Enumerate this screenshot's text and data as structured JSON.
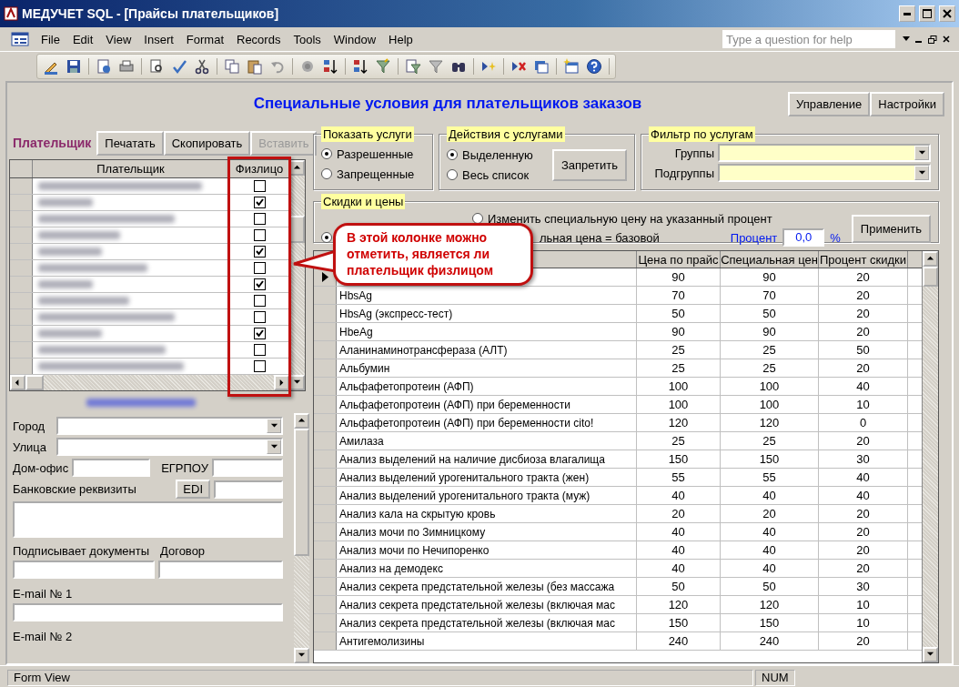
{
  "window": {
    "title": "МЕДУЧЕТ SQL - [Прайсы плательщиков]"
  },
  "menu": [
    "File",
    "Edit",
    "View",
    "Insert",
    "Format",
    "Records",
    "Tools",
    "Window",
    "Help"
  ],
  "help_box": {
    "placeholder": "Type a question for help"
  },
  "form": {
    "title": "Специальные условия для плательщиков заказов",
    "buttons": [
      "Управление",
      "Настройки"
    ]
  },
  "payer": {
    "label": "Плательщик",
    "buttons": [
      {
        "label": "Печатать",
        "disabled": false
      },
      {
        "label": "Скопировать",
        "disabled": false
      },
      {
        "label": "Вставить",
        "disabled": true
      }
    ],
    "columns": [
      "Плательщик",
      "Физлицо"
    ],
    "rows": [
      {
        "individual": false
      },
      {
        "individual": true
      },
      {
        "individual": false
      },
      {
        "individual": false
      },
      {
        "individual": true
      },
      {
        "individual": false
      },
      {
        "individual": true
      },
      {
        "individual": false
      },
      {
        "individual": false
      },
      {
        "individual": true
      },
      {
        "individual": false
      },
      {
        "individual": false
      }
    ]
  },
  "details": {
    "city_label": "Город",
    "street_label": "Улица",
    "office_label": "Дом-офис",
    "code_label": "ЕГРПОУ",
    "edi_button": "EDI",
    "bank_label": "Банковские реквизиты",
    "signer_label": "Подписывает документы",
    "contract_label": "Договор",
    "email1_label": "E-mail № 1",
    "email2_label": "E-mail № 2"
  },
  "show_services": {
    "title": "Показать услуги",
    "options": [
      {
        "label": "Разрешенные",
        "selected": true
      },
      {
        "label": "Запрещенные",
        "selected": false
      }
    ]
  },
  "service_actions": {
    "title": "Действия с услугами",
    "options": [
      {
        "label": "Выделенную",
        "selected": true
      },
      {
        "label": "Весь список",
        "selected": false
      }
    ],
    "button": "Запретить"
  },
  "filter": {
    "title": "Фильтр по услугам",
    "fields": [
      {
        "label": "Группы"
      },
      {
        "label": "Подгруппы"
      }
    ]
  },
  "discounts": {
    "title": "Скидки и цены",
    "options": [
      {
        "label": "Изменить специальную цену на указанный процент",
        "selected": false
      },
      {
        "label": "льная цена = базовой",
        "selected": true
      }
    ],
    "percent_label": "Процент",
    "percent_value": "0,0",
    "percent_unit": "%",
    "button": "Применить"
  },
  "services": {
    "columns": [
      "Цена по прайс",
      "Специальная цен",
      "Процент скидки"
    ],
    "rows": [
      {
        "price": "90",
        "special": "90",
        "discount": "20",
        "current": true
      },
      {
        "name": "HbsAg",
        "price": "70",
        "special": "70",
        "discount": "20",
        "current": false
      },
      {
        "name": "HbsAg (экспресс-тест)",
        "price": "50",
        "special": "50",
        "discount": "20",
        "current": false
      },
      {
        "name": "HbeAg",
        "price": "90",
        "special": "90",
        "discount": "20",
        "current": false
      },
      {
        "name": "Аланинаминотрансфераза (АЛТ)",
        "price": "25",
        "special": "25",
        "discount": "50",
        "current": false
      },
      {
        "name": "Альбумин",
        "price": "25",
        "special": "25",
        "discount": "20",
        "current": false
      },
      {
        "name": "Альфафетопротеин (АФП)",
        "price": "100",
        "special": "100",
        "discount": "40",
        "current": false
      },
      {
        "name": "Альфафетопротеин (АФП) при беременности",
        "price": "100",
        "special": "100",
        "discount": "10",
        "current": false
      },
      {
        "name": "Альфафетопротеин (АФП) при беременности cito!",
        "price": "120",
        "special": "120",
        "discount": "0",
        "current": false
      },
      {
        "name": "Амилаза",
        "price": "25",
        "special": "25",
        "discount": "20",
        "current": false
      },
      {
        "name": "Анализ выделений на наличие дисбиоза влагалища",
        "price": "150",
        "special": "150",
        "discount": "30",
        "current": false
      },
      {
        "name": "Анализ выделений урогенитального тракта (жен)",
        "price": "55",
        "special": "55",
        "discount": "40",
        "current": false
      },
      {
        "name": "Анализ выделений урогенитального тракта (муж)",
        "price": "40",
        "special": "40",
        "discount": "40",
        "current": false
      },
      {
        "name": "Анализ кала на скрытую кровь",
        "price": "20",
        "special": "20",
        "discount": "20",
        "current": false
      },
      {
        "name": "Анализ мочи по Зимницкому",
        "price": "40",
        "special": "40",
        "discount": "20",
        "current": false
      },
      {
        "name": "Анализ мочи по Нечипоренко",
        "price": "40",
        "special": "40",
        "discount": "20",
        "current": false
      },
      {
        "name": "Анализ на демодекс",
        "price": "40",
        "special": "40",
        "discount": "20",
        "current": false
      },
      {
        "name": "Анализ секрета предстательной железы (без массажа",
        "price": "50",
        "special": "50",
        "discount": "30",
        "current": false
      },
      {
        "name": "Анализ секрета предстательной железы (включая мас",
        "price": "120",
        "special": "120",
        "discount": "10",
        "current": false
      },
      {
        "name": "Анализ секрета предстательной железы (включая мас",
        "price": "150",
        "special": "150",
        "discount": "10",
        "current": false
      },
      {
        "name": "Антигемолизины",
        "price": "240",
        "special": "240",
        "discount": "20",
        "current": false
      }
    ]
  },
  "callout": {
    "text": "В этой колонке можно отметить, является ли плательщик физлицом"
  },
  "status_bar": {
    "mode": "Form View",
    "indicators": [
      "NUM"
    ]
  }
}
